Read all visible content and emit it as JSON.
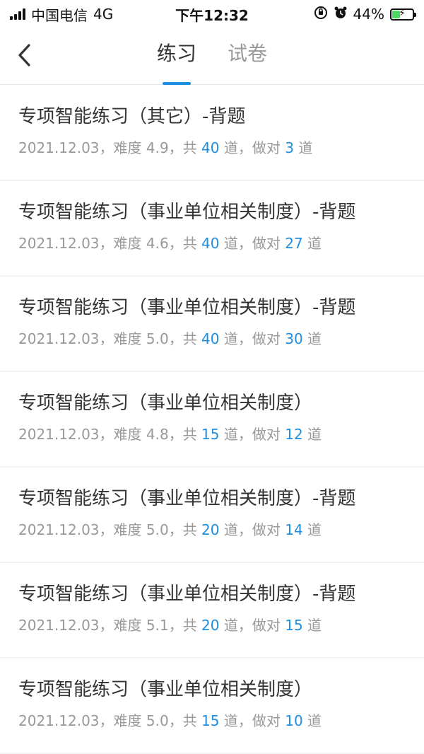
{
  "status_bar": {
    "carrier": "中国电信",
    "network": "4G",
    "time": "下午12:32",
    "battery": "44%",
    "battery_level": 0.44,
    "icons": [
      "signal-icon",
      "orientation-lock-icon",
      "alarm-icon",
      "battery-icon",
      "charging-bolt-icon"
    ]
  },
  "nav": {
    "back_icon": "chevron-left-icon",
    "tabs": [
      {
        "label": "练习",
        "active": true
      },
      {
        "label": "试卷",
        "active": false
      }
    ]
  },
  "meta_labels": {
    "difficulty": "难度",
    "total_prefix": "共",
    "correct_prefix": "做对",
    "unit": "道",
    "sep": "，"
  },
  "items": [
    {
      "title": "专项智能练习（其它）-背题",
      "date": "2021.12.03",
      "difficulty": "4.9",
      "total": "40",
      "correct": "3"
    },
    {
      "title": "专项智能练习（事业单位相关制度）-背题",
      "date": "2021.12.03",
      "difficulty": "4.6",
      "total": "40",
      "correct": "27"
    },
    {
      "title": "专项智能练习（事业单位相关制度）-背题",
      "date": "2021.12.03",
      "difficulty": "5.0",
      "total": "40",
      "correct": "30"
    },
    {
      "title": "专项智能练习（事业单位相关制度）",
      "date": "2021.12.03",
      "difficulty": "4.8",
      "total": "15",
      "correct": "12"
    },
    {
      "title": "专项智能练习（事业单位相关制度）-背题",
      "date": "2021.12.03",
      "difficulty": "5.0",
      "total": "20",
      "correct": "14"
    },
    {
      "title": "专项智能练习（事业单位相关制度）-背题",
      "date": "2021.12.03",
      "difficulty": "5.1",
      "total": "20",
      "correct": "15"
    },
    {
      "title": "专项智能练习（事业单位相关制度）",
      "date": "2021.12.03",
      "difficulty": "5.0",
      "total": "15",
      "correct": "10"
    }
  ],
  "colors": {
    "accent": "#1e8fe0",
    "text": "#333333",
    "muted": "#999999",
    "battery_green": "#4cd964"
  }
}
